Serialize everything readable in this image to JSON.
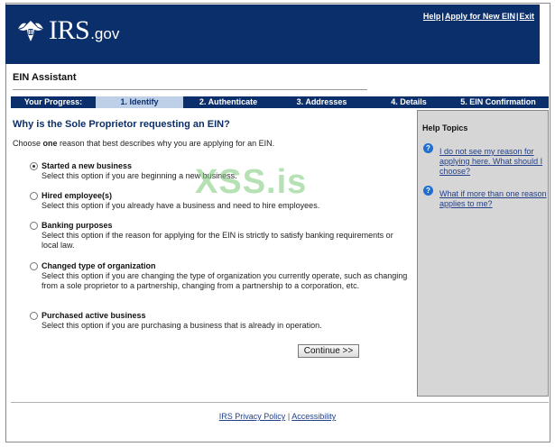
{
  "header": {
    "logo_text": "IRS",
    "logo_suffix": ".gov",
    "links": {
      "help": "Help",
      "apply_new_ein": "Apply for New EIN",
      "exit": "Exit",
      "separator": "|"
    },
    "icon": "irs-eagle-logo-icon"
  },
  "app": {
    "title": "EIN Assistant"
  },
  "progress": {
    "label": "Your Progress:",
    "steps": [
      "1. Identify",
      "2. Authenticate",
      "3. Addresses",
      "4. Details",
      "5. EIN Confirmation"
    ],
    "active_step": "1. Identify"
  },
  "main": {
    "question": "Why is the Sole Proprietor requesting an EIN?",
    "instruction_prefix": "Choose ",
    "instruction_emphasis": "one",
    "instruction_suffix": " reason that best describes why you are applying for an EIN.",
    "options": [
      {
        "title": "Started a new business",
        "description": "Select this option if you are beginning a new business.",
        "selected": true
      },
      {
        "title": "Hired employee(s)",
        "description": "Select this option if you already have a business and need to hire employees.",
        "selected": false
      },
      {
        "title": "Banking purposes",
        "description": "Select this option if the reason for applying for the EIN is strictly to satisfy banking requirements or local law.",
        "selected": false
      },
      {
        "title": "Changed type of organization",
        "description": "Select this option if you are changing the type of organization you currently operate, such as changing from a sole proprietor to a partnership, changing from a partnership to a corporation, etc.",
        "selected": false
      },
      {
        "title": "Purchased active business",
        "description": "Select this option if you are purchasing a business that is already in operation.",
        "selected": false
      }
    ],
    "continue_label": "Continue >>"
  },
  "help": {
    "title": "Help Topics",
    "items": [
      {
        "icon": "question-icon",
        "link": "I do not see my reason for applying here. What should I choose?"
      },
      {
        "icon": "question-icon",
        "link": "What if more than one reason applies to me?"
      }
    ]
  },
  "footer": {
    "privacy": "IRS Privacy Policy",
    "separator": "|",
    "accessibility": "Accessibility"
  },
  "watermark": "XSS.is",
  "colors": {
    "header_bg": "#0b2f6b",
    "active_step_bg": "#bed0e8",
    "help_panel_bg": "#d6d6d6",
    "link": "#24418a",
    "help_icon": "#1f6fd0"
  }
}
